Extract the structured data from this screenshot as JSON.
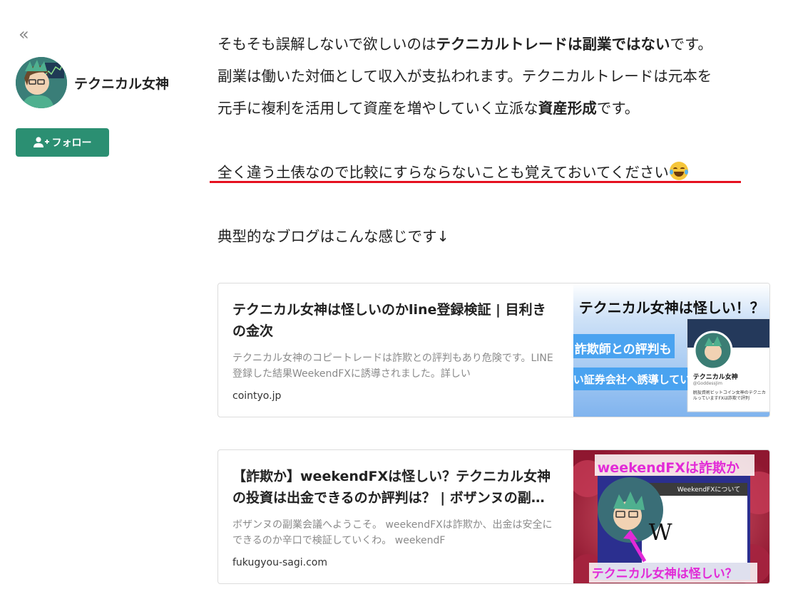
{
  "sidebar": {
    "collapse_label": "«",
    "creator_name": "テクニカル女神",
    "follow_label": "フォロー"
  },
  "article": {
    "p1": {
      "line1_a": "そもそも誤解しないで欲しいのは",
      "line1_b": "テクニカルトレードは副業ではない",
      "line1_c": "です。",
      "line2": "副業は働いた対価として収入が支払われます。テクニカルトレードは元本を",
      "line3_a": "元手に複利を活用して資産を増やしていく立派な",
      "line3_b": "資産形成",
      "line3_c": "です。"
    },
    "p2": "全く違う土俵なので比較にすらならないことも覚えておいてください",
    "p3": "典型的なブログはこんな感じです↓"
  },
  "cards": [
    {
      "title": "テクニカル女神は怪しいのかline登録検証 | 目利きの金次",
      "description": "テクニカル女神のコピートレードは詐欺との評判もあり危険です。LINE登録した結果WeekendFXに誘導されました。詳しい",
      "domain": "cointyo.jp",
      "thumb": {
        "headline": "テクニカル女神は怪しい！？",
        "badge1": "詐欺師との評判も",
        "badge2": "い証券会社へ誘導している",
        "profile_name": "テクニカル女神",
        "profile_handle": "@GoddessJim",
        "profile_bio": "脱投資術ビットコイン女神のテクニカルっていますFXは詐欺で評判",
        "colors": {
          "bg": "#a9cdf0",
          "badge": "#4aa3f0",
          "headline_bg": "#ffffff"
        }
      }
    },
    {
      "title": "【詐欺か】weekendFXは怪しい？テクニカル女神の投資は出金できるのか評判は？ | ボザンヌの副…",
      "description": "ボザンヌの副業会議へようこそ。 weekendFXは詐欺か、出金は安全にできるのか辛口で検証していくわ。 weekendF",
      "domain": "fukugyou-sagi.com",
      "thumb": {
        "headline": "weekendFXは詐欺か",
        "footer": "テクニカル女神は怪しい？",
        "panel_title": "WeekendFXについて",
        "panel_letter": "W",
        "colors": {
          "bg": "#b3263b",
          "accent": "#e22ad7",
          "panel": "#ffffff"
        }
      }
    }
  ]
}
